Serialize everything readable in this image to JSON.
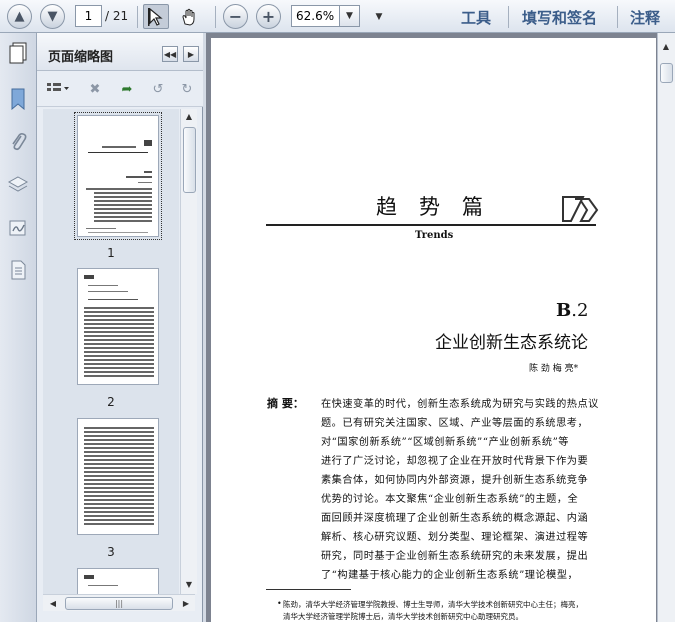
{
  "toolbar": {
    "page_current": "1",
    "page_total": "/ 21",
    "zoom": "62.6%",
    "tools_label": "工具",
    "fill_sign_label": "填写和签名",
    "comment_label": "注释"
  },
  "panel": {
    "title": "页面缩略图",
    "thumbnails": [
      {
        "label": "1"
      },
      {
        "label": "2"
      },
      {
        "label": "3"
      }
    ]
  },
  "document": {
    "section_title": "趋势篇",
    "section_title_en": "Trends",
    "report_number_prefix": "B",
    "report_number_suffix": ".2",
    "chapter_title": "企业创新生态系统论",
    "authors": "陈 劲 梅 亮*",
    "abstract_label": "摘 要：",
    "abstract_lines": [
      "在快速变革的时代，创新生态系统成为研究与实践的热点议",
      "题。已有研究关注国家、区域、产业等层面的系统思考，",
      "对“国家创新系统”“区域创新系统”“产业创新系统”等",
      "进行了广泛讨论，却忽视了企业在开放时代背景下作为要",
      "素集合体，如何协同内外部资源，提升创新生态系统竞争",
      "优势的讨论。本文聚焦“企业创新生态系统”的主题，全",
      "面回顾并深度梳理了企业创新生态系统的概念源起、内涵",
      "解析、核心研究议题、划分类型、理论框架、演进过程等",
      "研究，同时基于企业创新生态系统研究的未来发展，提出",
      "了“构建基于核心能力的企业创新生态系统”理论模型，"
    ],
    "footnote_lines": [
      "陈劲，清华大学经济管理学院教授、博士生导师，清华大学技术创新研究中心主任；梅亮，",
      "清华大学经济管理学院博士后，清华大学技术创新研究中心助理研究员。"
    ]
  }
}
